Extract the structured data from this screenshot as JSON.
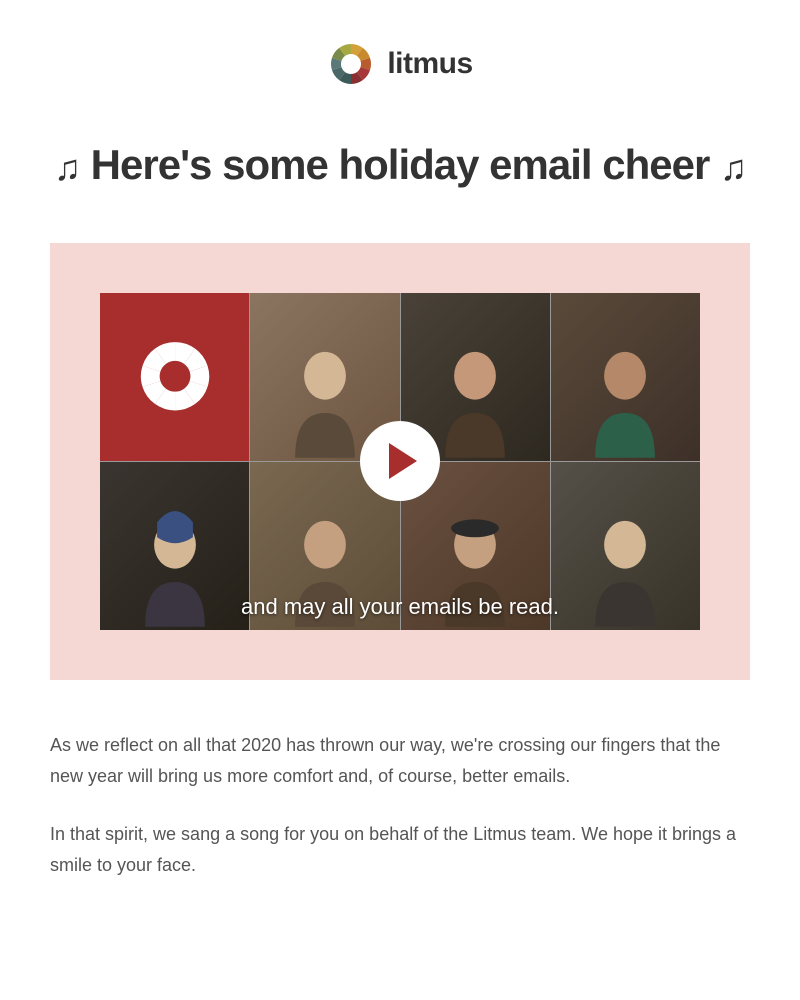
{
  "brand": {
    "name": "litmus"
  },
  "headline": {
    "text": "Here's some holiday email cheer",
    "note_left": "♫",
    "note_right": "♫"
  },
  "video": {
    "caption": "and may all your emails be read."
  },
  "body": {
    "paragraph1": "As we reflect on all that 2020 has thrown our way, we're crossing our fingers that the new year will bring us more comfort and, of course, better emails.",
    "paragraph2": "In that spirit, we sang a song for you on behalf of the Litmus team. We hope it brings a smile to your face."
  }
}
